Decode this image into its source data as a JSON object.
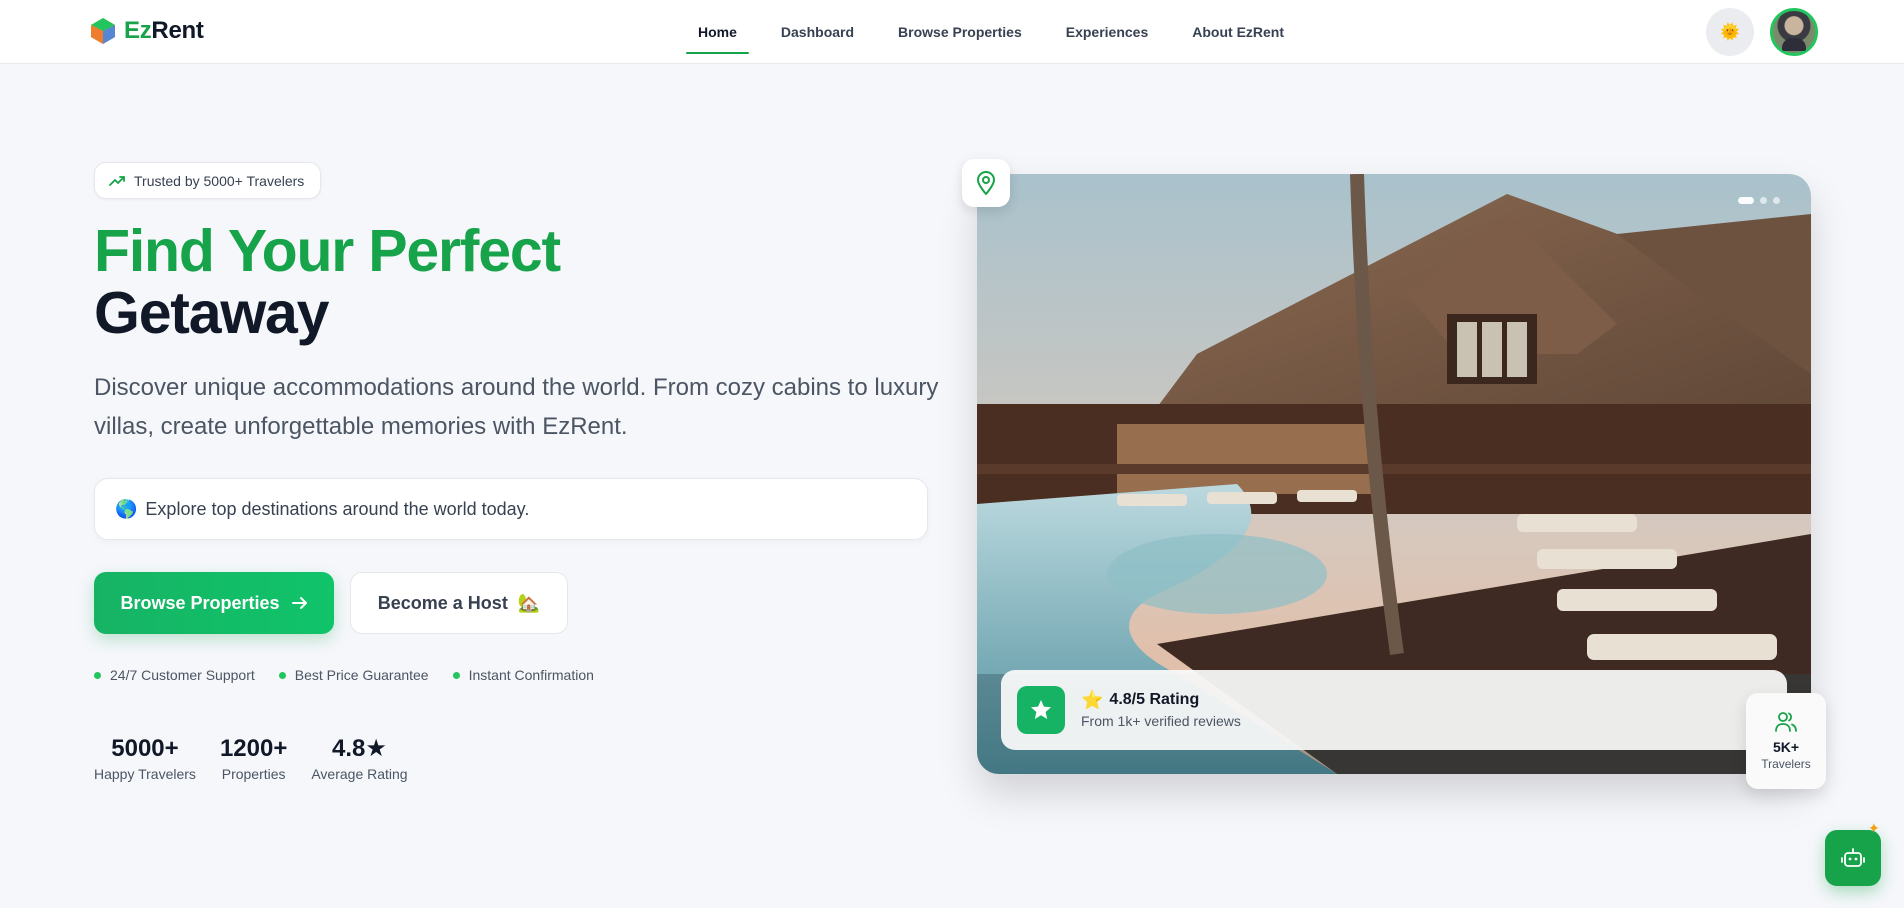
{
  "brand": {
    "name_part1": "Ez",
    "name_part2": "Rent"
  },
  "nav": {
    "items": [
      {
        "label": "Home",
        "active": true
      },
      {
        "label": "Dashboard"
      },
      {
        "label": "Browse Properties"
      },
      {
        "label": "Experiences"
      },
      {
        "label": "About EzRent"
      }
    ],
    "theme_icon": "🌞"
  },
  "hero": {
    "badge": "Trusted by 5000+ Travelers",
    "title_line1": "Find Your Perfect",
    "title_line2": "Getaway",
    "description": "Discover unique accommodations around the world. From cozy cabins to luxury villas, create unforgettable memories with EzRent.",
    "explore_icon": "🌎",
    "explore_text": "Explore top destinations around the world today.",
    "primary_button": "Browse Properties",
    "secondary_button": "Become a Host",
    "secondary_button_icon": "🏡",
    "features": [
      "24/7 Customer Support",
      "Best Price Guarantee",
      "Instant Confirmation"
    ],
    "stats": [
      {
        "value": "5000+",
        "label": "Happy Travelers"
      },
      {
        "value": "1200+",
        "label": "Properties"
      },
      {
        "value": "4.8★",
        "label": "Average Rating"
      }
    ]
  },
  "image_card": {
    "rating_icon": "⭐",
    "rating_title": "4.8/5 Rating",
    "rating_subtitle": "From 1k+ verified reviews",
    "travelers_value": "5K+",
    "travelers_label": "Travelers",
    "carousel_dots": 3,
    "active_slide": 1
  },
  "colors": {
    "accent": "#16a34a",
    "heading_dark": "#111827"
  }
}
